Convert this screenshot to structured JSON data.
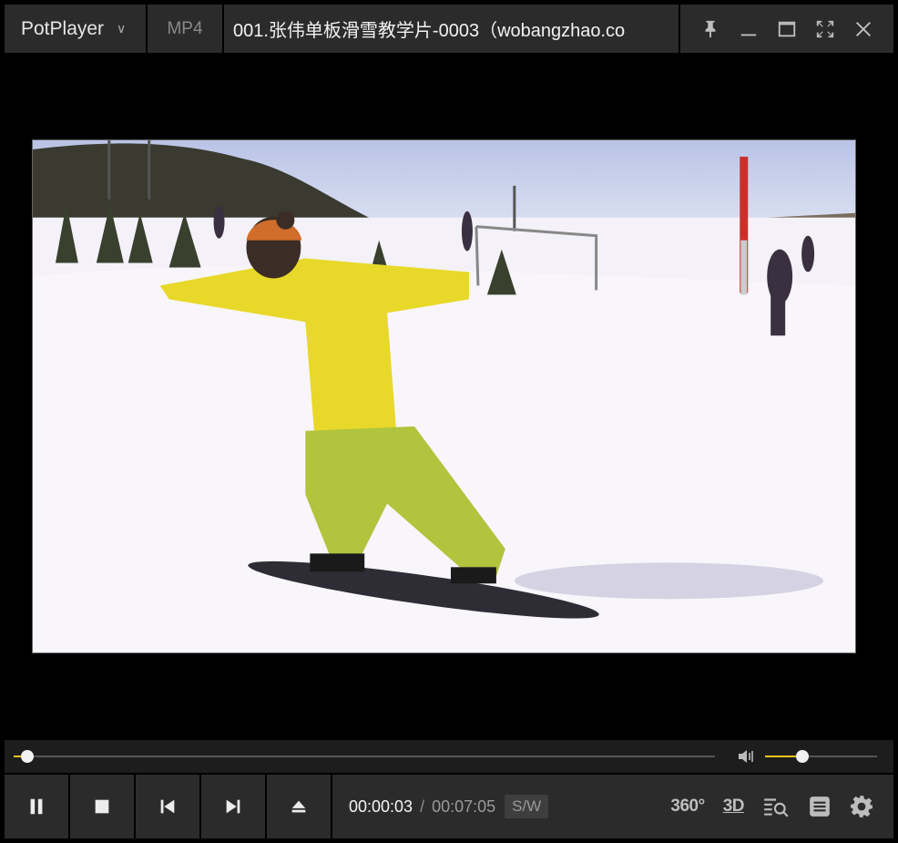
{
  "titlebar": {
    "app_name": "PotPlayer",
    "format": "MP4",
    "file_title": "001.张伟单板滑雪教学片-0003（wobangzhao.co"
  },
  "window_controls": {
    "icons": [
      "pin-icon",
      "minimize-icon",
      "maximize-icon",
      "fullscreen-icon",
      "close-icon"
    ]
  },
  "video": {
    "scene": "snowboard-instruction-frame"
  },
  "playback": {
    "current_time": "00:00:03",
    "separator": "/",
    "total_time": "00:07:05",
    "mode_badge": "S/W",
    "seek_fraction": 0.02,
    "volume_fraction": 0.33
  },
  "tools": {
    "label_360": "360°",
    "label_3d": "3D"
  },
  "colors": {
    "accent": "#f3c31c",
    "panel": "#2b2b2b",
    "background": "#000000"
  }
}
